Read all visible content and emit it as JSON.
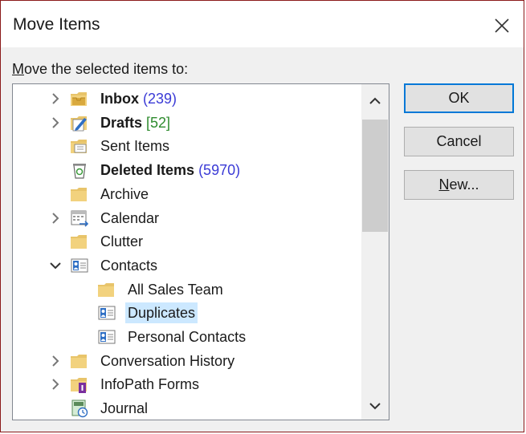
{
  "dialog": {
    "title": "Move Items",
    "prompt_accel": "M",
    "prompt_rest": "ove the selected items to:"
  },
  "tree": {
    "items": [
      {
        "name": "Inbox",
        "count": "(239)",
        "count_style": "blue",
        "bold": true,
        "expander": "collapsed",
        "icon": "inbox-folder-icon",
        "level": 0
      },
      {
        "name": "Drafts",
        "count": "[52]",
        "count_style": "green",
        "bold": true,
        "expander": "collapsed",
        "icon": "drafts-folder-icon",
        "level": 0
      },
      {
        "name": "Sent Items",
        "count": "",
        "bold": false,
        "expander": "none",
        "icon": "sent-items-folder-icon",
        "level": 0
      },
      {
        "name": "Deleted Items",
        "count": "(5970)",
        "count_style": "blue",
        "bold": true,
        "expander": "none",
        "icon": "recycle-bin-icon",
        "level": 0
      },
      {
        "name": "Archive",
        "count": "",
        "bold": false,
        "expander": "none",
        "icon": "folder-icon",
        "level": 0
      },
      {
        "name": "Calendar",
        "count": "",
        "bold": false,
        "expander": "collapsed",
        "icon": "calendar-folder-icon",
        "level": 0
      },
      {
        "name": "Clutter",
        "count": "",
        "bold": false,
        "expander": "none",
        "icon": "folder-icon",
        "level": 0
      },
      {
        "name": "Contacts",
        "count": "",
        "bold": false,
        "expander": "expanded",
        "icon": "contacts-folder-icon",
        "level": 0
      },
      {
        "name": "All Sales Team",
        "count": "",
        "bold": false,
        "expander": "none",
        "icon": "folder-icon",
        "level": 1
      },
      {
        "name": "Duplicates",
        "count": "",
        "bold": false,
        "expander": "none",
        "icon": "contacts-folder-icon",
        "level": 1,
        "selected": true
      },
      {
        "name": "Personal Contacts",
        "count": "",
        "bold": false,
        "expander": "none",
        "icon": "contacts-folder-icon",
        "level": 1
      },
      {
        "name": "Conversation History",
        "count": "",
        "bold": false,
        "expander": "collapsed",
        "icon": "folder-icon",
        "level": 0
      },
      {
        "name": "InfoPath Forms",
        "count": "",
        "bold": false,
        "expander": "collapsed",
        "icon": "infopath-folder-icon",
        "level": 0
      },
      {
        "name": "Journal",
        "count": "",
        "bold": false,
        "expander": "none",
        "icon": "journal-folder-icon",
        "level": 0
      }
    ]
  },
  "buttons": {
    "ok": "OK",
    "cancel": "Cancel",
    "new_accel": "N",
    "new_rest": "ew..."
  },
  "colors": {
    "count_blue": "#3a3ad6",
    "count_green": "#2e8b2e",
    "folder_yellow": "#e8c46a",
    "selection": "#cce8ff",
    "default_button_border": "#0078d7"
  }
}
